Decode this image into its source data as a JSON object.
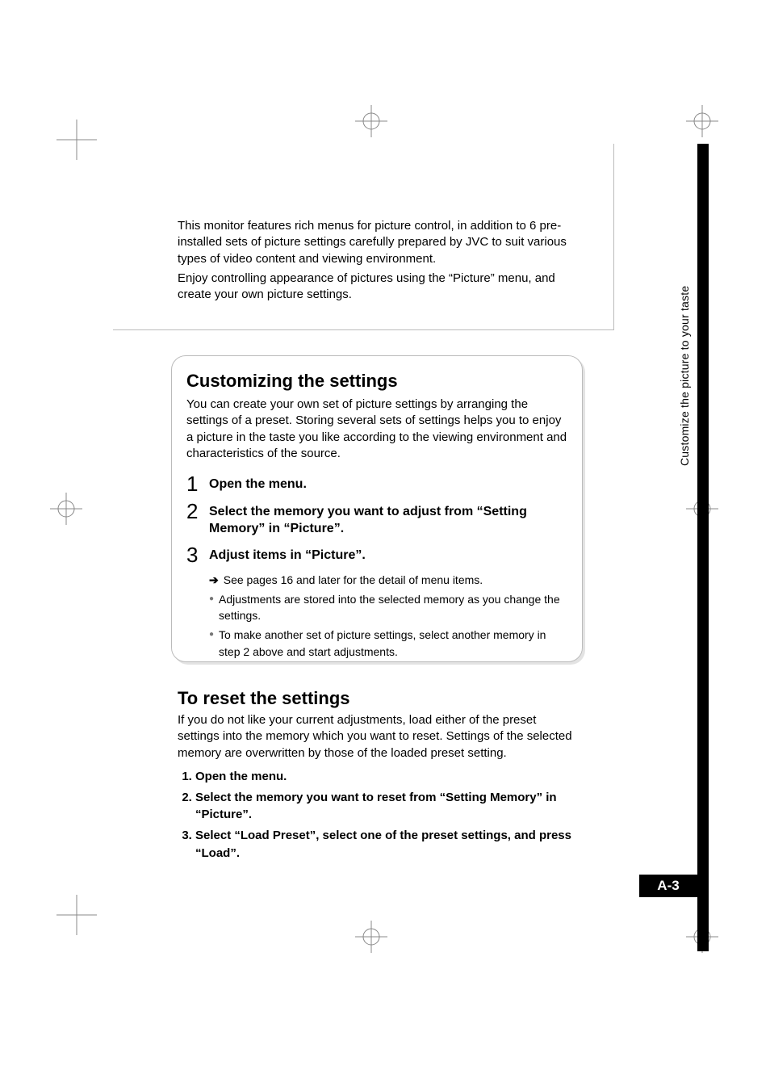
{
  "sideTab": {
    "label": "Customize the picture to your taste"
  },
  "intro": {
    "p1": "This monitor features rich menus for picture control, in addition to 6 pre-installed sets of picture settings carefully prepared by JVC to suit various types of video content and viewing environment.",
    "p2": "Enjoy controlling appearance of pictures using the “Picture” menu, and create your own picture settings."
  },
  "customizing": {
    "heading": "Customizing the settings",
    "lead": "You can create your own set of picture settings by arranging the settings of a preset. Storing several sets of settings helps you to enjoy a picture in the taste you like according to the viewing environment and characteristics of the source.",
    "steps": [
      {
        "num": "1",
        "text": "Open the menu."
      },
      {
        "num": "2",
        "text": "Select the memory you want to adjust from “Setting Memory” in “Picture”."
      },
      {
        "num": "3",
        "text": "Adjust items in “Picture”."
      }
    ],
    "sub": {
      "arrowText": "See pages 16 and later for the detail of menu items.",
      "bullets": [
        "Adjustments are stored into the selected memory as you change the settings.",
        "To make another set of picture settings, select another memory in step 2 above and start adjustments."
      ]
    }
  },
  "reset": {
    "heading": "To reset the settings",
    "lead": "If you do not like your current adjustments, load either of the preset settings into the memory which you want to reset. Settings of the selected memory are overwritten by those of the loaded preset setting.",
    "steps": [
      "Open the menu.",
      "Select the memory you want to reset from “Setting Memory” in “Picture”.",
      "Select “Load Preset”, select one of the preset settings, and press “Load”."
    ]
  },
  "pageNumber": "A-3"
}
